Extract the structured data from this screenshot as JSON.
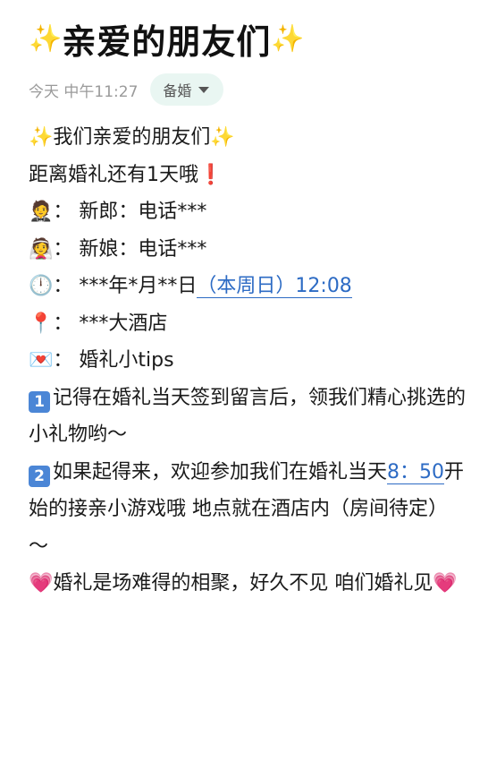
{
  "note": {
    "title": "亲爱的朋友们",
    "title_decor": "✨",
    "timestamp": "今天 中午11:27",
    "tag": "备婚"
  },
  "content": {
    "greeting": "我们亲爱的朋友们",
    "countdown": "距离婚礼还有1天哦",
    "countdown_icon": "❗",
    "groom_emoji": "🤵",
    "groom": "：  新郎：电话***",
    "bride_emoji": "👰",
    "bride": "：  新娘：电话***",
    "time_emoji": "🕛",
    "date_prefix": "：  ***年*月**日",
    "date_link": "（本周日）12:08",
    "location_emoji": "📍",
    "location": "：  ***大酒店",
    "tips_emoji": "💌",
    "tips_heading": "：  婚礼小tips",
    "tip1_num": "1",
    "tip1": "记得在婚礼当天签到留言后，领我们精心挑选的小礼物哟～",
    "tip2_num": "2",
    "tip2_a": "如果起得来，欢迎参加我们在婚礼当天",
    "tip2_time_link": "8：50",
    "tip2_b": "开始的接亲小游戏哦 地点就在酒店内（房间待定）～",
    "closing_heart": "💗",
    "closing": "婚礼是场难得的相聚，好久不见 咱们婚礼见"
  }
}
